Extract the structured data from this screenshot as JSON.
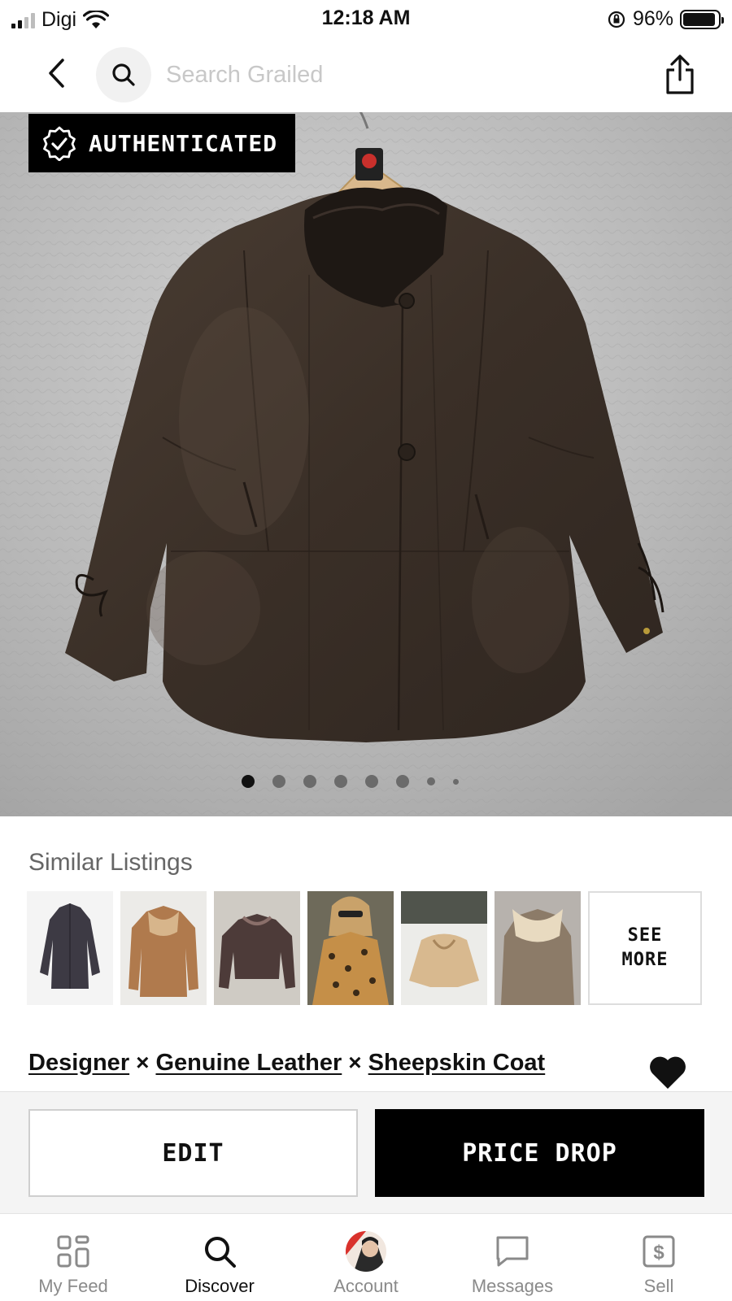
{
  "status_bar": {
    "carrier": "Digi",
    "time": "12:18 AM",
    "battery": "96%"
  },
  "nav": {
    "search_placeholder": "Search Grailed"
  },
  "hero": {
    "badge": "AUTHENTICATED",
    "image_count": 8,
    "active_image": 1
  },
  "similar": {
    "title": "Similar Listings",
    "see_more_line1": "SEE",
    "see_more_line2": "MORE"
  },
  "listing": {
    "title_parts": [
      "Designer",
      "Genuine Leather",
      "Sheepskin Coat"
    ],
    "separator": "×",
    "favorited": true
  },
  "actions": {
    "edit": "EDIT",
    "price_drop": "PRICE DROP"
  },
  "tabs": [
    {
      "label": "My Feed",
      "icon": "grid-icon",
      "active": false
    },
    {
      "label": "Discover",
      "icon": "search-icon",
      "active": true
    },
    {
      "label": "Account",
      "icon": "avatar",
      "active": false
    },
    {
      "label": "Messages",
      "icon": "chat-bubble-icon",
      "active": false
    },
    {
      "label": "Sell",
      "icon": "dollar-tag-icon",
      "active": false
    }
  ],
  "colors": {
    "primary": "#000000",
    "background": "#ffffff",
    "muted_text": "#8a8a8a",
    "action_bar_bg": "#f4f4f4"
  }
}
